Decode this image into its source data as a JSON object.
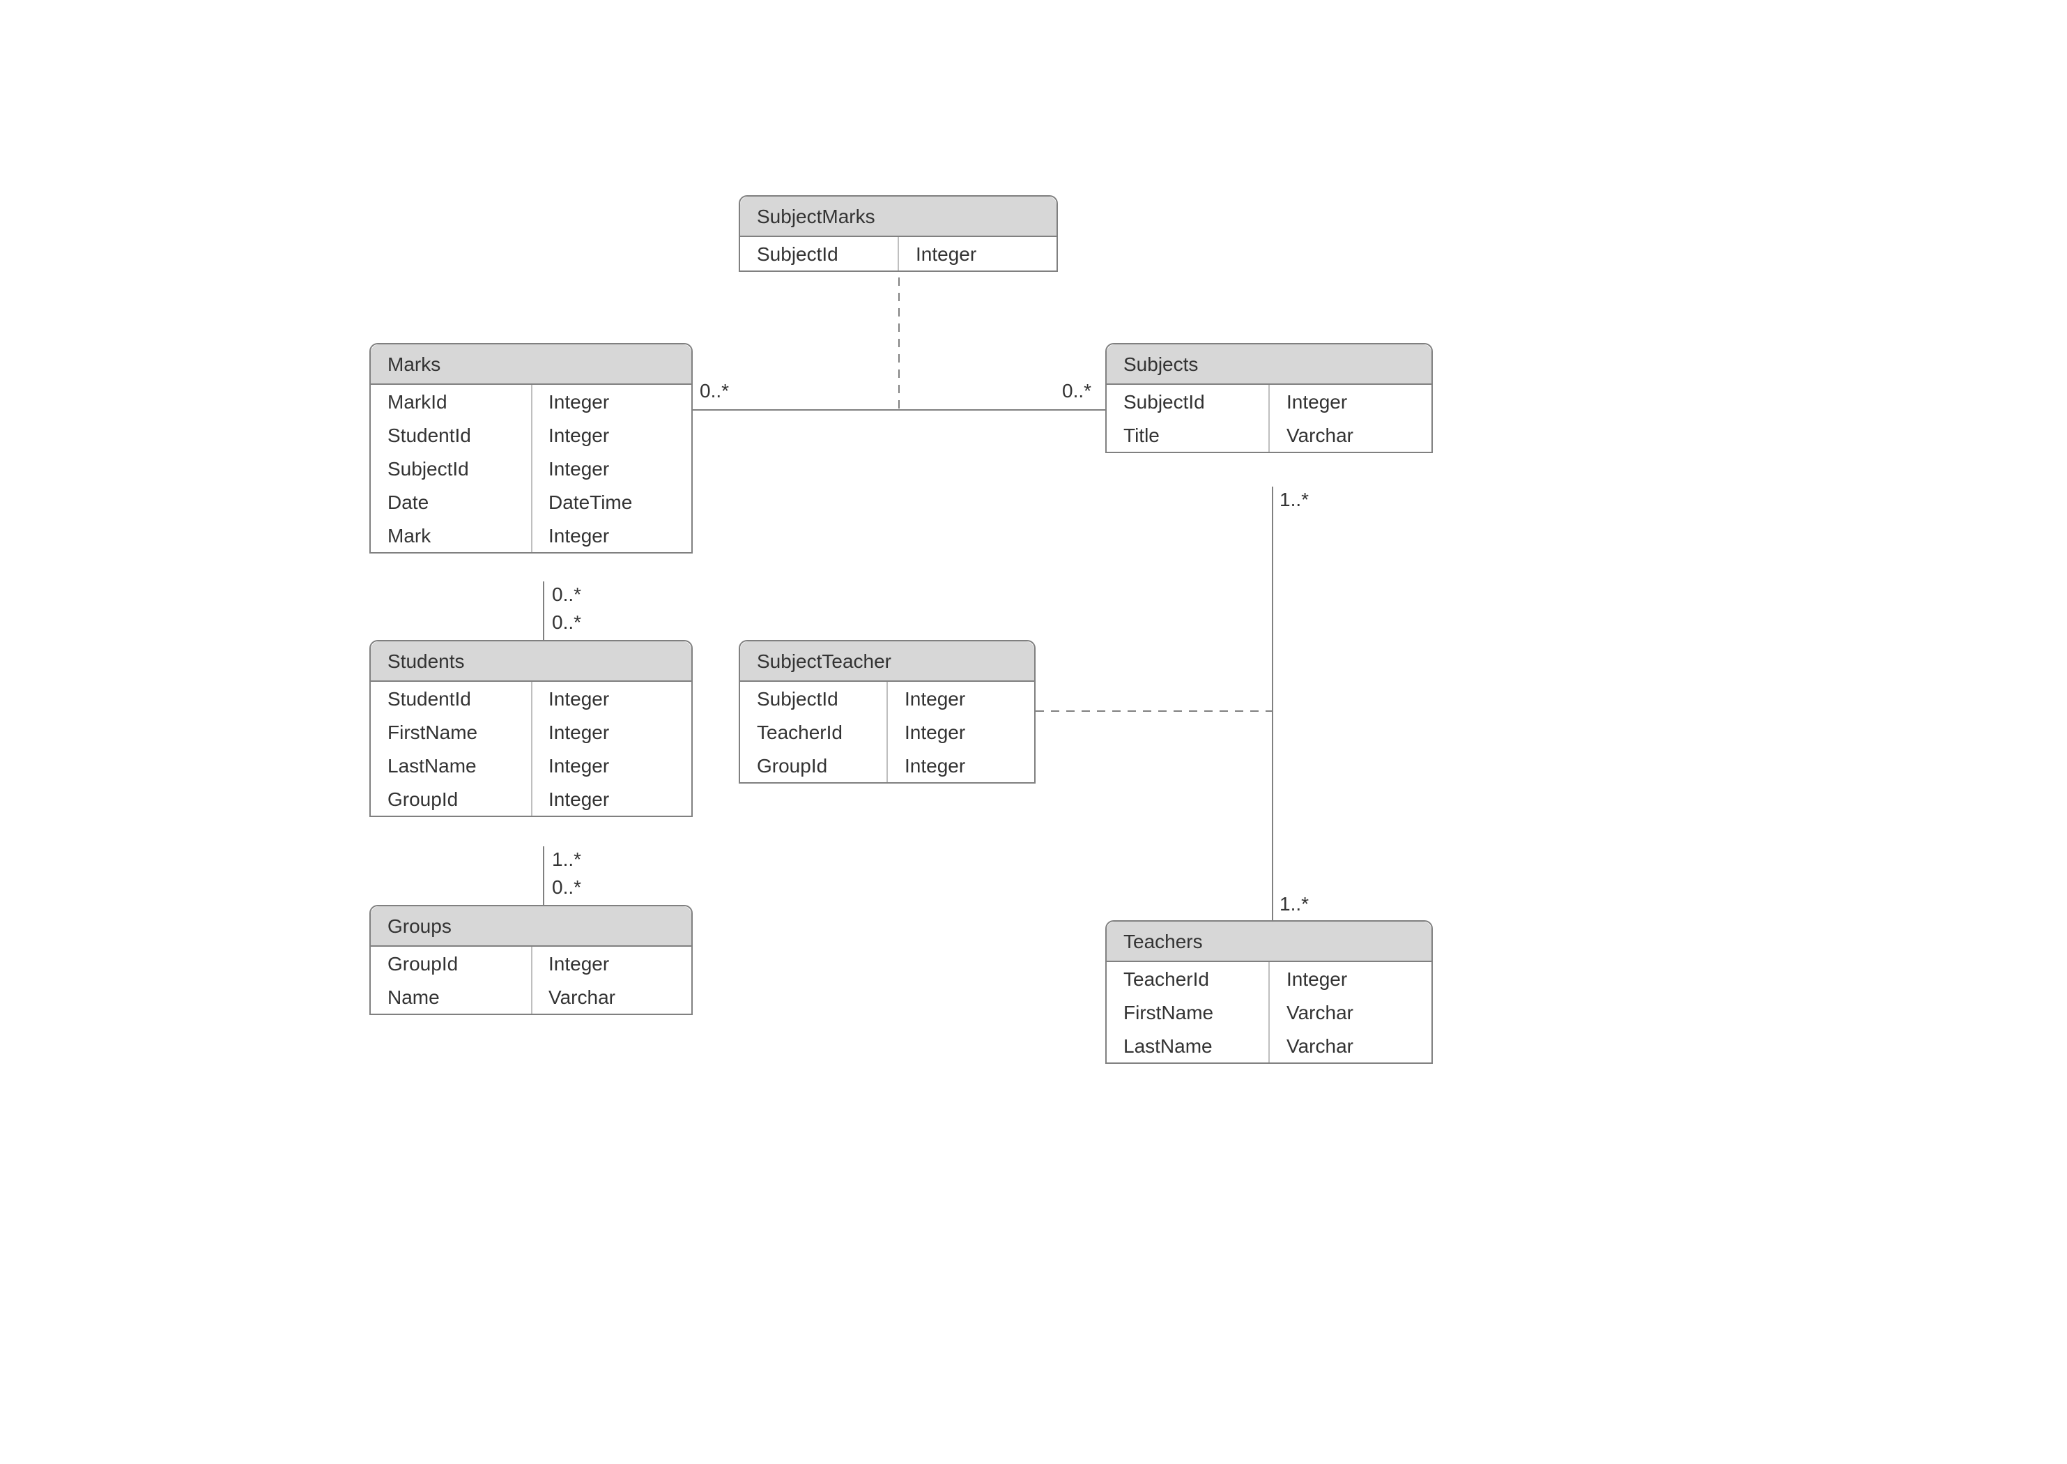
{
  "entities": {
    "subjectMarks": {
      "title": "SubjectMarks",
      "rows": [
        {
          "name": "SubjectId",
          "type": "Integer"
        }
      ]
    },
    "marks": {
      "title": "Marks",
      "rows": [
        {
          "name": "MarkId",
          "type": "Integer"
        },
        {
          "name": "StudentId",
          "type": "Integer"
        },
        {
          "name": "SubjectId",
          "type": "Integer"
        },
        {
          "name": "Date",
          "type": "DateTime"
        },
        {
          "name": "Mark",
          "type": "Integer"
        }
      ]
    },
    "subjects": {
      "title": "Subjects",
      "rows": [
        {
          "name": "SubjectId",
          "type": "Integer"
        },
        {
          "name": "Title",
          "type": "Varchar"
        }
      ]
    },
    "students": {
      "title": "Students",
      "rows": [
        {
          "name": "StudentId",
          "type": "Integer"
        },
        {
          "name": "FirstName",
          "type": "Integer"
        },
        {
          "name": "LastName",
          "type": "Integer"
        },
        {
          "name": "GroupId",
          "type": "Integer"
        }
      ]
    },
    "subjectTeacher": {
      "title": "SubjectTeacher",
      "rows": [
        {
          "name": "SubjectId",
          "type": "Integer"
        },
        {
          "name": "TeacherId",
          "type": "Integer"
        },
        {
          "name": "GroupId",
          "type": "Integer"
        }
      ]
    },
    "groups": {
      "title": "Groups",
      "rows": [
        {
          "name": "GroupId",
          "type": "Integer"
        },
        {
          "name": "Name",
          "type": "Varchar"
        }
      ]
    },
    "teachers": {
      "title": "Teachers",
      "rows": [
        {
          "name": "TeacherId",
          "type": "Integer"
        },
        {
          "name": "FirstName",
          "type": "Varchar"
        },
        {
          "name": "LastName",
          "type": "Varchar"
        }
      ]
    }
  },
  "multiplicities": {
    "marksSubjects_left": "0..*",
    "marksSubjects_right": "0..*",
    "subjectsTeachers_top": "1..*",
    "subjectsTeachers_bottom": "1..*",
    "marksStudents_top": "0..*",
    "marksStudents_bottom": "0..*",
    "studentsGroups_top": "1..*",
    "studentsGroups_bottom": "0..*"
  }
}
